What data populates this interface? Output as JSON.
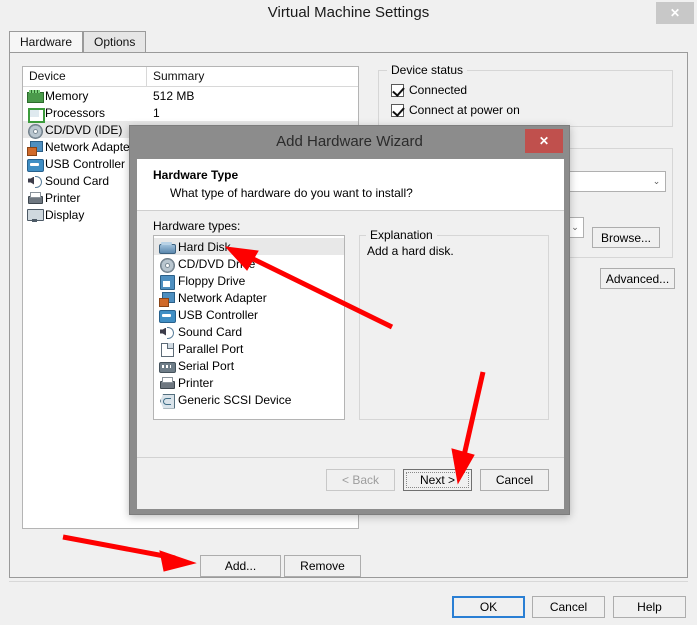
{
  "window": {
    "title": "Virtual Machine Settings",
    "close_label": "✕"
  },
  "tabs": [
    {
      "label": "Hardware",
      "active": true
    },
    {
      "label": "Options",
      "active": false
    }
  ],
  "device_list": {
    "columns": [
      "Device",
      "Summary"
    ],
    "rows": [
      {
        "icon": "memory-icon",
        "name": "Memory",
        "summary": "512 MB",
        "selected": false
      },
      {
        "icon": "processor-icon",
        "name": "Processors",
        "summary": "1",
        "selected": false
      },
      {
        "icon": "cd-dvd-icon",
        "name": "CD/DVD (IDE)",
        "summary": "",
        "selected": true
      },
      {
        "icon": "network-adapter-icon",
        "name": "Network Adapter",
        "summary": "",
        "selected": false
      },
      {
        "icon": "usb-controller-icon",
        "name": "USB Controller",
        "summary": "",
        "selected": false
      },
      {
        "icon": "sound-card-icon",
        "name": "Sound Card",
        "summary": "",
        "selected": false
      },
      {
        "icon": "printer-icon",
        "name": "Printer",
        "summary": "",
        "selected": false
      },
      {
        "icon": "display-icon",
        "name": "Display",
        "summary": "",
        "selected": false
      }
    ]
  },
  "device_status": {
    "legend": "Device status",
    "checkboxes": [
      {
        "label": "Connected",
        "checked": true
      },
      {
        "label": "Connect at power on",
        "checked": true
      }
    ]
  },
  "connection": {
    "combo_value": "",
    "dropdown_arrow": "⌄",
    "browse_label": "Browse...",
    "advanced_label": "Advanced..."
  },
  "list_actions": {
    "add_label": "Add...",
    "remove_label": "Remove"
  },
  "footer": {
    "ok_label": "OK",
    "cancel_label": "Cancel",
    "help_label": "Help"
  },
  "wizard": {
    "title": "Add Hardware Wizard",
    "close_label": "✕",
    "heading": "Hardware Type",
    "subheading": "What type of hardware do you want to install?",
    "hardware_types_label": "Hardware types:",
    "hardware_types": [
      {
        "icon": "hard-disk-icon",
        "label": "Hard Disk",
        "selected": true
      },
      {
        "icon": "cd-dvd-drive-icon",
        "label": "CD/DVD Drive",
        "selected": false
      },
      {
        "icon": "floppy-drive-icon",
        "label": "Floppy Drive",
        "selected": false
      },
      {
        "icon": "network-adapter-icon",
        "label": "Network Adapter",
        "selected": false
      },
      {
        "icon": "usb-controller-icon",
        "label": "USB Controller",
        "selected": false
      },
      {
        "icon": "sound-card-icon",
        "label": "Sound Card",
        "selected": false
      },
      {
        "icon": "parallel-port-icon",
        "label": "Parallel Port",
        "selected": false
      },
      {
        "icon": "serial-port-icon",
        "label": "Serial Port",
        "selected": false
      },
      {
        "icon": "printer-icon",
        "label": "Printer",
        "selected": false
      },
      {
        "icon": "generic-scsi-icon",
        "label": "Generic SCSI Device",
        "selected": false
      }
    ],
    "explanation_legend": "Explanation",
    "explanation_text": "Add a hard disk.",
    "buttons": {
      "back_label": "< Back",
      "next_label": "Next >",
      "cancel_label": "Cancel"
    }
  },
  "annotations": {
    "color": "#fe0000",
    "arrows": [
      {
        "name": "arrow-to-hard-disk",
        "points_to": "Hard Disk"
      },
      {
        "name": "arrow-to-next-button",
        "points_to": "Next >"
      },
      {
        "name": "arrow-to-add-button",
        "points_to": "Add..."
      }
    ]
  }
}
